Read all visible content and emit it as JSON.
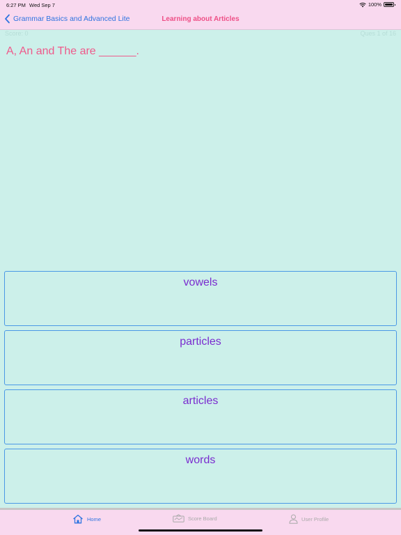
{
  "status_bar": {
    "time": "6:27 PM",
    "date": "Wed Sep 7",
    "battery": "100%"
  },
  "nav": {
    "back_label": "Grammar Basics and Advanced Lite",
    "title": "Learning about Articles"
  },
  "quiz": {
    "score": "Score: 0",
    "ques_count": "Ques 1 of 16",
    "question": "A, An and The are ______.",
    "answers": [
      "vowels",
      "particles",
      "articles",
      "words"
    ]
  },
  "tabs": [
    {
      "label": "Home",
      "icon": "home-icon",
      "active": true
    },
    {
      "label": "Score Board",
      "icon": "scoreboard-icon",
      "active": false
    },
    {
      "label": "User Profile",
      "icon": "user-icon",
      "active": false
    }
  ],
  "colors": {
    "background": "#ccf0ea",
    "bar_background": "#f9d9ef",
    "accent_blue": "#2f74e0",
    "title_pink": "#ee4f86",
    "answer_purple": "#7a2ccf",
    "answer_border": "#4a98e6"
  }
}
